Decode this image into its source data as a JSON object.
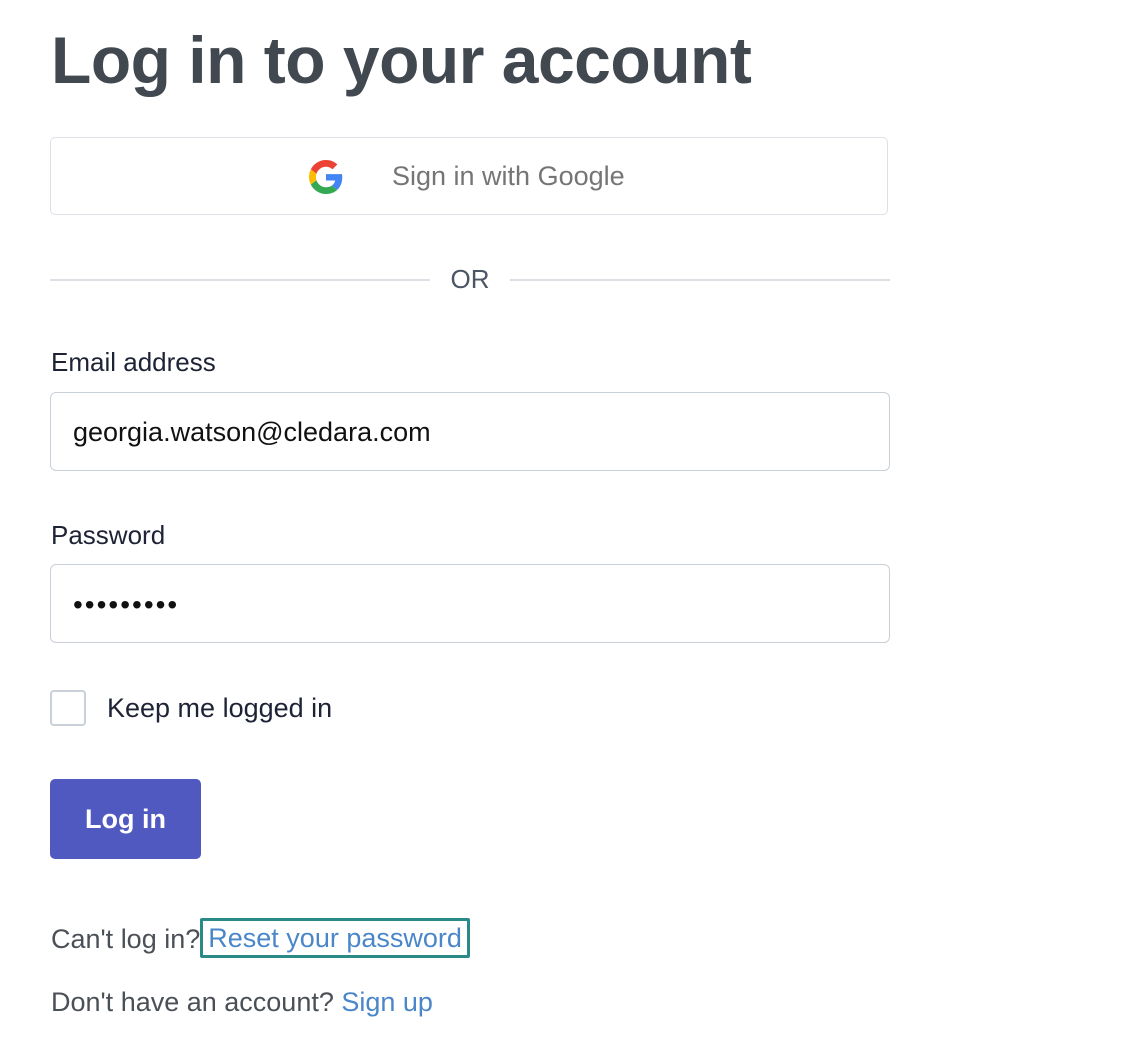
{
  "page": {
    "title": "Log in to your account"
  },
  "google_signin": {
    "label": "Sign in with Google",
    "icon": "google-g-icon"
  },
  "divider": {
    "text": "OR"
  },
  "email": {
    "label": "Email address",
    "value": "georgia.watson@cledara.com"
  },
  "password": {
    "label": "Password",
    "value": "•••••••••"
  },
  "keep_logged_in": {
    "label": "Keep me logged in",
    "checked": false
  },
  "login_button": {
    "label": "Log in"
  },
  "footer": {
    "cant_login_text": "Can't log in?",
    "reset_link": "Reset your password",
    "no_account_text": "Don't have an account?",
    "signup_link": "Sign up"
  },
  "colors": {
    "primary_button": "#5059c0",
    "link": "#4a86c8",
    "focus_outline": "#2a8a87",
    "title": "#414850"
  }
}
